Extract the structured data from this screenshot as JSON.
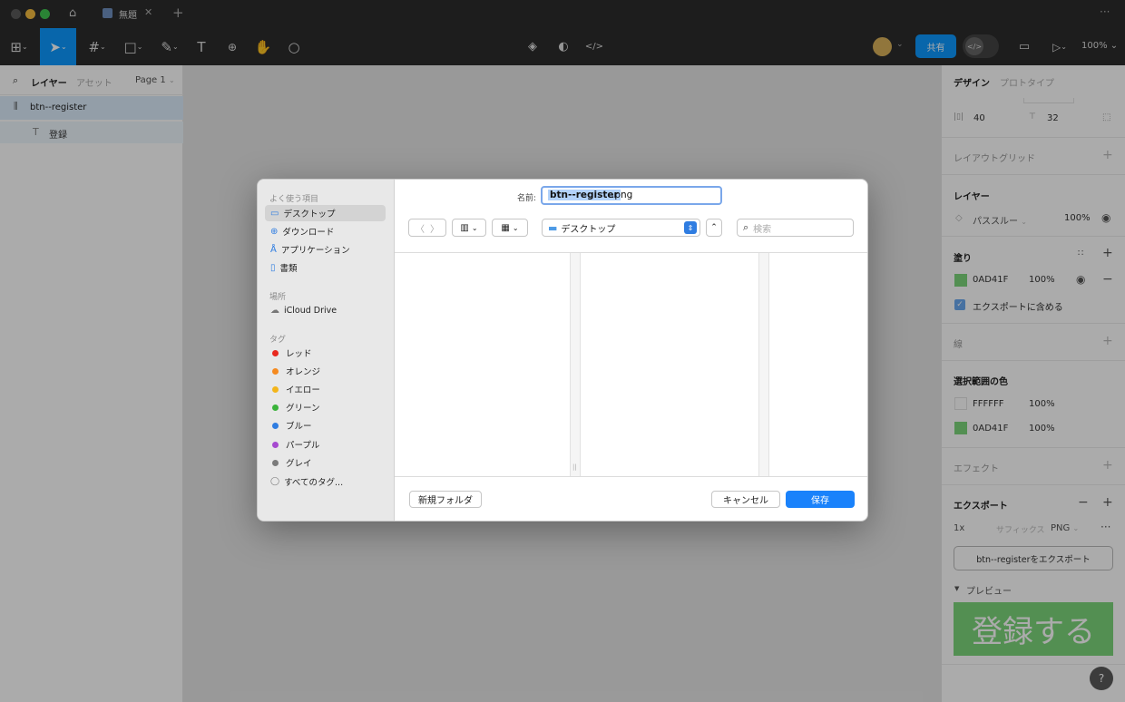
{
  "titlebar": {
    "tab_title": "無題"
  },
  "toolbar": {
    "share_label": "共有",
    "zoom": "100%"
  },
  "left_panel": {
    "tabs": [
      "レイヤー",
      "アセット"
    ],
    "page": "Page 1",
    "layers": [
      {
        "name": "btn--register"
      },
      {
        "name": "登録"
      }
    ]
  },
  "right_panel": {
    "tabs": [
      "デザイン",
      "プロトタイプ"
    ],
    "width": "40",
    "height": "32",
    "layout_grid": "レイアウトグリッド",
    "layer_title": "レイヤー",
    "blend_mode": "パススルー",
    "layer_opacity": "100%",
    "fill_title": "塗り",
    "fill_color": "0AD41F",
    "fill_opacity": "100%",
    "export_check": "エクスポートに含める",
    "stroke_title": "線",
    "selection_colors_title": "選択範囲の色",
    "selection_colors": [
      {
        "hex": "FFFFFF",
        "opacity": "100%",
        "swatch": "#ffffff"
      },
      {
        "hex": "0AD41F",
        "opacity": "100%",
        "swatch": "#7dd67b"
      }
    ],
    "effects_title": "エフェクト",
    "export_title": "エクスポート",
    "export_scale": "1x",
    "export_suffix": "サフィックス",
    "export_format": "PNG",
    "export_button": "btn--registerをエクスポート",
    "preview_title": "プレビュー",
    "preview_text": "登録する",
    "help": "?"
  },
  "dialog": {
    "name_label": "名前:",
    "filename": "btn--register.png",
    "filename_selected": "btn--register",
    "filename_ext": ".png",
    "location": "デスクトップ",
    "search_placeholder": "検索",
    "sidebar": {
      "favorites_title": "よく使う項目",
      "favorites": [
        {
          "label": "デスクトップ",
          "icon": "desktop-icon"
        },
        {
          "label": "ダウンロード",
          "icon": "download-icon"
        },
        {
          "label": "アプリケーション",
          "icon": "applications-icon"
        },
        {
          "label": "書類",
          "icon": "document-icon"
        }
      ],
      "locations_title": "場所",
      "locations": [
        {
          "label": "iCloud Drive",
          "icon": "cloud-icon"
        }
      ],
      "tags_title": "タグ",
      "tags": [
        {
          "label": "レッド",
          "color": "#e8281e"
        },
        {
          "label": "オレンジ",
          "color": "#f58a1f"
        },
        {
          "label": "イエロー",
          "color": "#f3b51b"
        },
        {
          "label": "グリーン",
          "color": "#3ab33a"
        },
        {
          "label": "ブルー",
          "color": "#2f7de1"
        },
        {
          "label": "パープル",
          "color": "#a64ad0"
        },
        {
          "label": "グレイ",
          "color": "#7b7b7b"
        }
      ],
      "all_tags": "すべてのタグ..."
    },
    "new_folder": "新規フォルダ",
    "cancel": "キャンセル",
    "save": "保存"
  },
  "colors": {
    "accent": "#0d99ff",
    "fill_green": "#7dd67b"
  }
}
